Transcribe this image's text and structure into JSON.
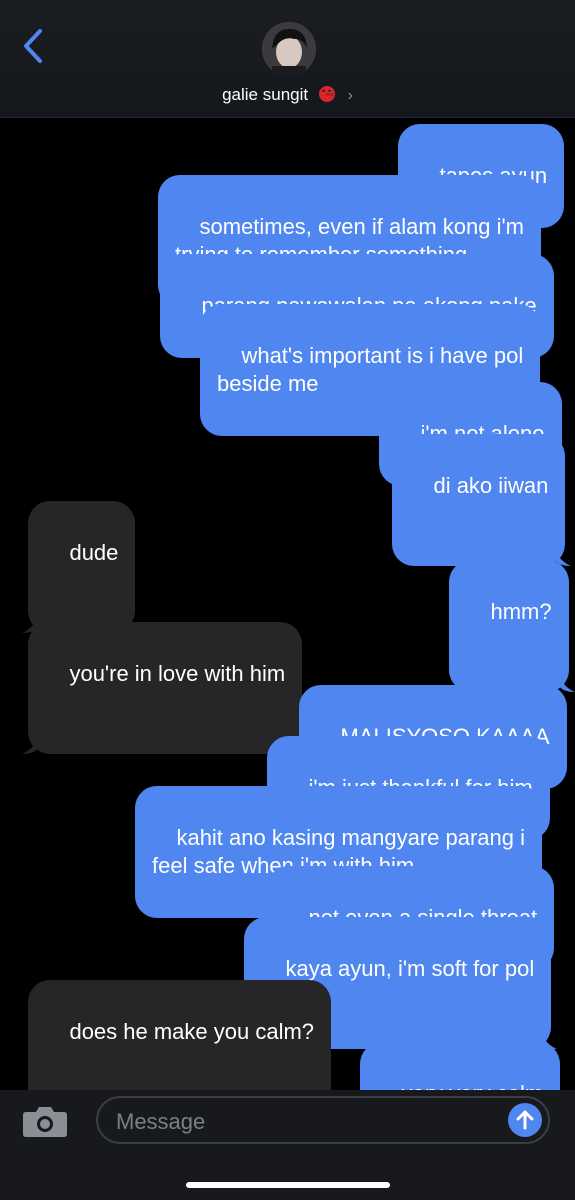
{
  "header": {
    "contact_name": "galie sungit",
    "chevron": "›",
    "back_icon": "chevron-left-icon",
    "accent": "#4f86f0"
  },
  "messages": [
    {
      "side": "sent",
      "text": "tapos ayun"
    },
    {
      "side": "sent",
      "text": "sometimes, even if alam kong i'm\ntrying to remember something"
    },
    {
      "side": "sent",
      "text": "parang nawawalan na akong pake"
    },
    {
      "side": "sent",
      "text": "what's important is i have pol\nbeside me"
    },
    {
      "side": "sent",
      "text": "i'm not alone"
    },
    {
      "side": "sent",
      "text": "di ako iiwan"
    },
    {
      "side": "recv",
      "text": "dude"
    },
    {
      "side": "sent",
      "text": "hmm?"
    },
    {
      "side": "recv",
      "text": "you're in love with him"
    },
    {
      "side": "sent",
      "text": "MALISYOSO KAAAA"
    },
    {
      "side": "sent",
      "text": "i'm just thankful for him"
    },
    {
      "side": "sent",
      "text": "kahit ano kasing mangyare parang i\nfeel safe when i'm with him"
    },
    {
      "side": "sent",
      "text": "not even a single threat"
    },
    {
      "side": "sent",
      "text": "kaya ayun, i'm soft for pol"
    },
    {
      "side": "recv",
      "text": "does he make you calm?"
    },
    {
      "side": "sent",
      "text": "very very calm"
    }
  ],
  "composer": {
    "placeholder": "Message",
    "camera_icon": "camera-icon",
    "send_icon": "arrow-up-icon"
  }
}
